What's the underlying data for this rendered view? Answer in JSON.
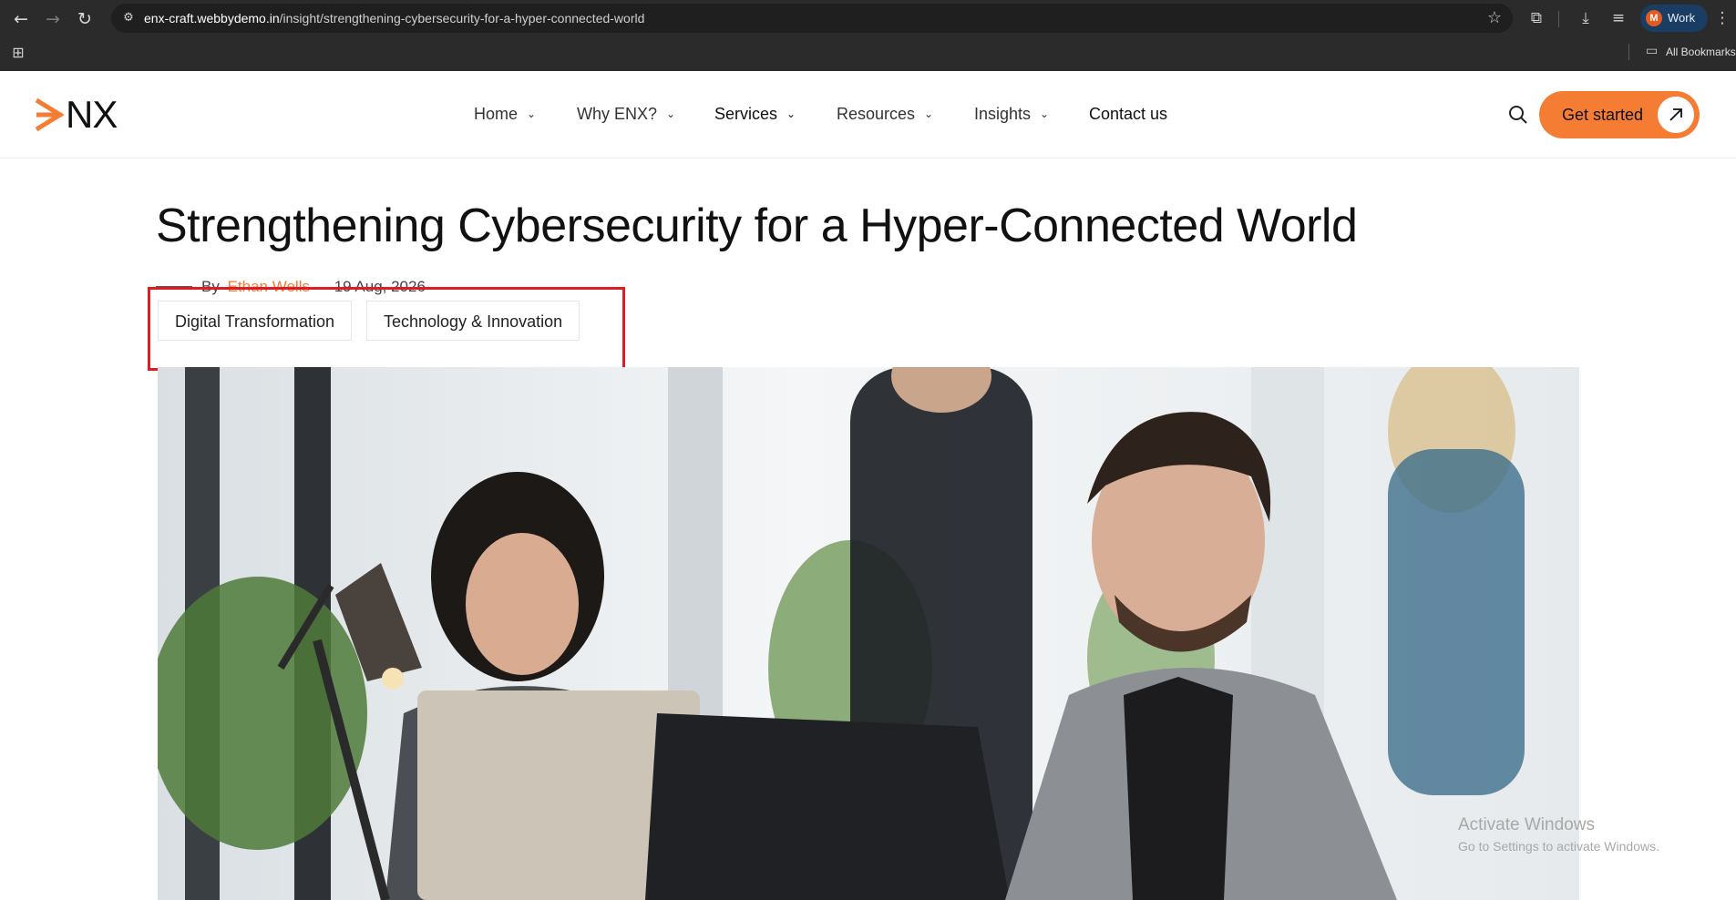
{
  "browser": {
    "url_host": "enx-craft.webbydemo.in",
    "url_path": "/insight/strengthening-cybersecurity-for-a-hyper-connected-world",
    "profile_initial": "M",
    "profile_name": "Work",
    "bookmarks_label": "All Bookmarks",
    "icons": [
      "back-icon",
      "forward-icon",
      "reload-icon",
      "site-settings-icon",
      "star-icon",
      "extensions-icon",
      "download-icon",
      "reading-list-icon",
      "apps-icon",
      "folder-icon"
    ]
  },
  "site": {
    "logo_text": "NX",
    "brand_color": "#f47d33",
    "nav": [
      {
        "label": "Home",
        "has_dropdown": true
      },
      {
        "label": "Why ENX?",
        "has_dropdown": true
      },
      {
        "label": "Services",
        "has_dropdown": true
      },
      {
        "label": "Resources",
        "has_dropdown": true
      },
      {
        "label": "Insights",
        "has_dropdown": true
      },
      {
        "label": "Contact us",
        "has_dropdown": false
      }
    ],
    "cta_label": "Get started"
  },
  "article": {
    "title": "Strengthening Cybersecurity for a Hyper-Connected World",
    "by": "By",
    "author": "Ethan Wells",
    "date": "19 Aug, 2026",
    "tags": [
      "Digital Transformation",
      "Technology & Innovation"
    ]
  },
  "watermark": {
    "line1": "Activate Windows",
    "line2": "Go to Settings to activate Windows."
  }
}
